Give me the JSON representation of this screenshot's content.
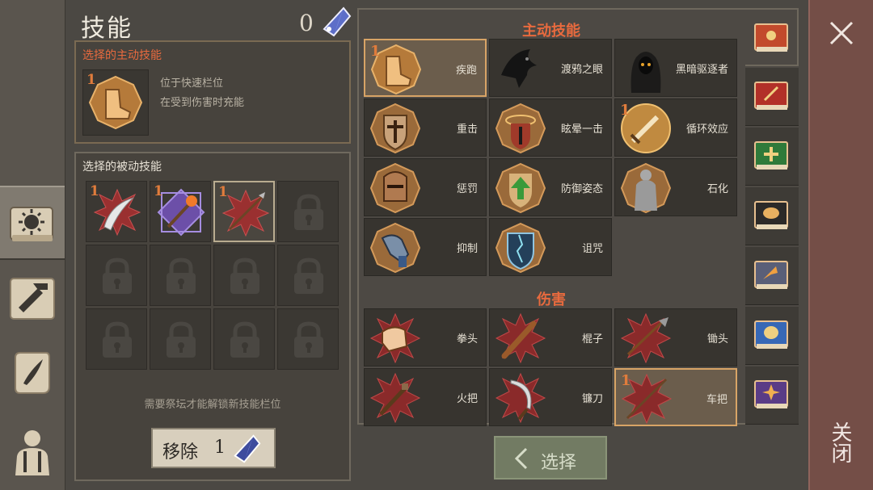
{
  "header": {
    "title": "技能",
    "skill_points": "0",
    "points_icon": "crystal-gem-icon"
  },
  "active_skill_panel": {
    "heading": "选择的主动技能",
    "selected_level": "1",
    "description_lines": [
      "位于快速栏位",
      "在受到伤害时充能"
    ]
  },
  "passive_skill_panel": {
    "heading": "选择的被动技能",
    "slots": [
      {
        "level": "1",
        "icon": "scimitar-icon",
        "selected": false
      },
      {
        "level": "1",
        "icon": "torch-icon",
        "selected": false
      },
      {
        "level": "1",
        "icon": "spear-icon",
        "selected": true
      },
      {
        "locked": true
      },
      {
        "locked": true
      },
      {
        "locked": true
      },
      {
        "locked": true
      },
      {
        "locked": true
      },
      {
        "locked": true
      },
      {
        "locked": true
      },
      {
        "locked": true
      },
      {
        "locked": true
      }
    ],
    "unlock_note": "需要祭坛才能解锁新技能栏位",
    "remove_button": {
      "label": "移除",
      "count": "1"
    }
  },
  "skill_list": {
    "sections": [
      {
        "title": "主动技能",
        "skills": [
          {
            "name": "疾跑",
            "icon": "boot-icon",
            "level": "1",
            "selected": true
          },
          {
            "name": "渡鸦之眼",
            "icon": "raven-icon",
            "level": "",
            "selected": false
          },
          {
            "name": "黑暗驱逐者",
            "icon": "hooded-figure-icon",
            "level": "",
            "selected": false
          },
          {
            "name": "重击",
            "icon": "shield-bash-icon",
            "level": "",
            "selected": false
          },
          {
            "name": "眩晕一击",
            "icon": "stun-shield-icon",
            "level": "",
            "selected": false
          },
          {
            "name": "循环效应",
            "icon": "sword-icon",
            "level": "1",
            "selected": false
          },
          {
            "name": "惩罚",
            "icon": "knight-helmet-icon",
            "level": "",
            "selected": false
          },
          {
            "name": "防御姿态",
            "icon": "defense-arrow-icon",
            "level": "",
            "selected": false
          },
          {
            "name": "石化",
            "icon": "stone-statue-icon",
            "level": "",
            "selected": false
          },
          {
            "name": "抑制",
            "icon": "gauntlet-icon",
            "level": "",
            "selected": false
          },
          {
            "name": "诅咒",
            "icon": "cracked-shield-icon",
            "level": "",
            "selected": false
          }
        ]
      },
      {
        "title": "伤害",
        "skills": [
          {
            "name": "拳头",
            "icon": "fist-icon",
            "level": "",
            "selected": false
          },
          {
            "name": "棍子",
            "icon": "club-icon",
            "level": "",
            "selected": false
          },
          {
            "name": "锄头",
            "icon": "hoe-icon",
            "level": "",
            "selected": false
          },
          {
            "name": "火把",
            "icon": "torch-icon",
            "level": "",
            "selected": false
          },
          {
            "name": "镰刀",
            "icon": "sickle-icon",
            "level": "",
            "selected": false
          },
          {
            "name": "车把",
            "icon": "spear-icon",
            "level": "1",
            "selected": true
          }
        ]
      }
    ]
  },
  "category_tabs": [
    {
      "icon": "sun-book-icon",
      "color": "#c24a2c",
      "active": true
    },
    {
      "icon": "sword-book-icon",
      "color": "#b23028",
      "active": false
    },
    {
      "icon": "cross-book-icon",
      "color": "#2f7a3a",
      "active": false
    },
    {
      "icon": "mask-book-icon",
      "color": "#2c2a28",
      "active": false
    },
    {
      "icon": "arrow-book-icon",
      "color": "#5a5f78",
      "active": false
    },
    {
      "icon": "theater-book-icon",
      "color": "#3768b6",
      "active": false
    },
    {
      "icon": "spark-book-icon",
      "color": "#5a3c86",
      "active": false
    }
  ],
  "left_tabs": [
    {
      "icon": "skills-book-icon",
      "active": true
    },
    {
      "icon": "crafting-hammer-icon",
      "active": false
    },
    {
      "icon": "scroll-quill-icon",
      "active": false
    },
    {
      "icon": "character-icon",
      "active": false
    }
  ],
  "select_button": {
    "label": "选择"
  },
  "close_panel": {
    "label": "关闭"
  },
  "colors": {
    "accent_orange": "#e86a3e",
    "badge_orange": "#e07c3c",
    "close_red": "#744e47"
  }
}
